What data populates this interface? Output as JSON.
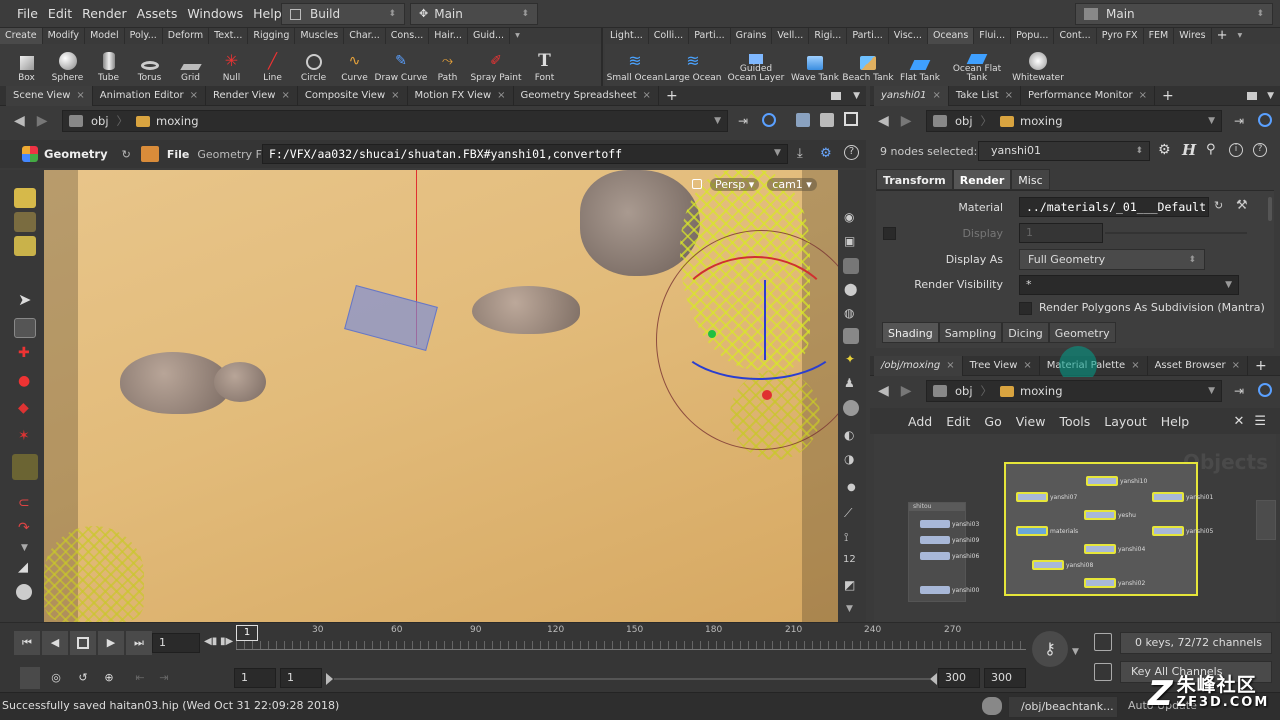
{
  "menubar": {
    "items": [
      "File",
      "Edit",
      "Render",
      "Assets",
      "Windows",
      "Help"
    ],
    "desktop": "Build",
    "context": "Main",
    "right_desktop": "Main"
  },
  "shelf_left": {
    "tabs": [
      "Create",
      "Modify",
      "Model",
      "Poly...",
      "Deform",
      "Text...",
      "Rigging",
      "Muscles",
      "Char...",
      "Cons...",
      "Hair...",
      "Guid..."
    ],
    "tools": [
      "Box",
      "Sphere",
      "Tube",
      "Torus",
      "Grid",
      "Null",
      "Line",
      "Circle",
      "Curve",
      "Draw Curve",
      "Path",
      "Spray Paint",
      "Font"
    ]
  },
  "shelf_right": {
    "tabs": [
      "Light...",
      "Colli...",
      "Parti...",
      "Grains",
      "Vell...",
      "Rigi...",
      "Parti...",
      "Visc...",
      "Oceans",
      "Flui...",
      "Popu...",
      "Cont...",
      "Pyro FX",
      "FEM",
      "Wires"
    ],
    "tools": [
      "Small Ocean",
      "Large Ocean",
      "Guided Ocean Layer",
      "Wave Tank",
      "Beach Tank",
      "Flat Tank",
      "Ocean Flat Tank",
      "Whitewater"
    ]
  },
  "left_pane": {
    "tabs": [
      "Scene View",
      "Animation Editor",
      "Render View",
      "Composite View",
      "Motion FX View",
      "Geometry Spreadsheet"
    ],
    "path": [
      "obj",
      "moxing"
    ],
    "op_label": "Geometry",
    "op_type": "File",
    "param_label": "Geometry File",
    "param_value": "F:/VFX/aa032/shucai/shuatan.FBX#yanshi01,convertoff",
    "camera_menu": "Persp",
    "camera_name": "cam1"
  },
  "params_pane": {
    "tabs": [
      "yanshi01",
      "Take List",
      "Performance Monitor"
    ],
    "path": [
      "obj",
      "moxing"
    ],
    "selection": "9 nodes selected:",
    "node": "yanshi01",
    "sub_tabs": [
      "Transform",
      "Render",
      "Misc"
    ],
    "material_label": "Material",
    "material_value": "../materials/_01___Default",
    "display_label": "Display",
    "display_value": "1",
    "display_as_label": "Display As",
    "display_as_value": "Full Geometry",
    "render_vis_label": "Render Visibility",
    "render_vis_value": "*",
    "subdiv_label": "Render Polygons As Subdivision (Mantra)",
    "render_tabs": [
      "Shading",
      "Sampling",
      "Dicing",
      "Geometry"
    ]
  },
  "network_pane": {
    "tabs": [
      "/obj/moxing",
      "Tree View",
      "Material Palette",
      "Asset Browser"
    ],
    "path": [
      "obj",
      "moxing"
    ],
    "menu": [
      "Add",
      "Edit",
      "Go",
      "View",
      "Tools",
      "Layout",
      "Help"
    ],
    "watermark": "Objects",
    "left_box": "shitou",
    "left_nodes": [
      "yanshi03",
      "yanshi09",
      "yanshi06",
      "yanshi00"
    ],
    "right_nodes": [
      "yanshi10",
      "yanshi07",
      "yanshi01",
      "yeshu",
      "materials",
      "yanshi05",
      "yanshi04",
      "yanshi08",
      "yanshi02"
    ]
  },
  "timeline": {
    "frame": "1",
    "ticks": [
      "1",
      "30",
      "60",
      "90",
      "120",
      "150",
      "180",
      "210",
      "240",
      "270"
    ],
    "range_start": "1",
    "range_start2": "1",
    "range_end": "300",
    "range_end2": "300",
    "keys_info": "0 keys, 72/72 channels",
    "key_all": "Key All Channels"
  },
  "status": {
    "message": "Successfully saved haitan03.hip (Wed Oct 31 22:09:28 2018)",
    "path": "/obj/beachtank...",
    "auto_update": "Auto Update"
  },
  "brand": {
    "name": "朱峰社区",
    "url": "ZF3D.COM"
  }
}
